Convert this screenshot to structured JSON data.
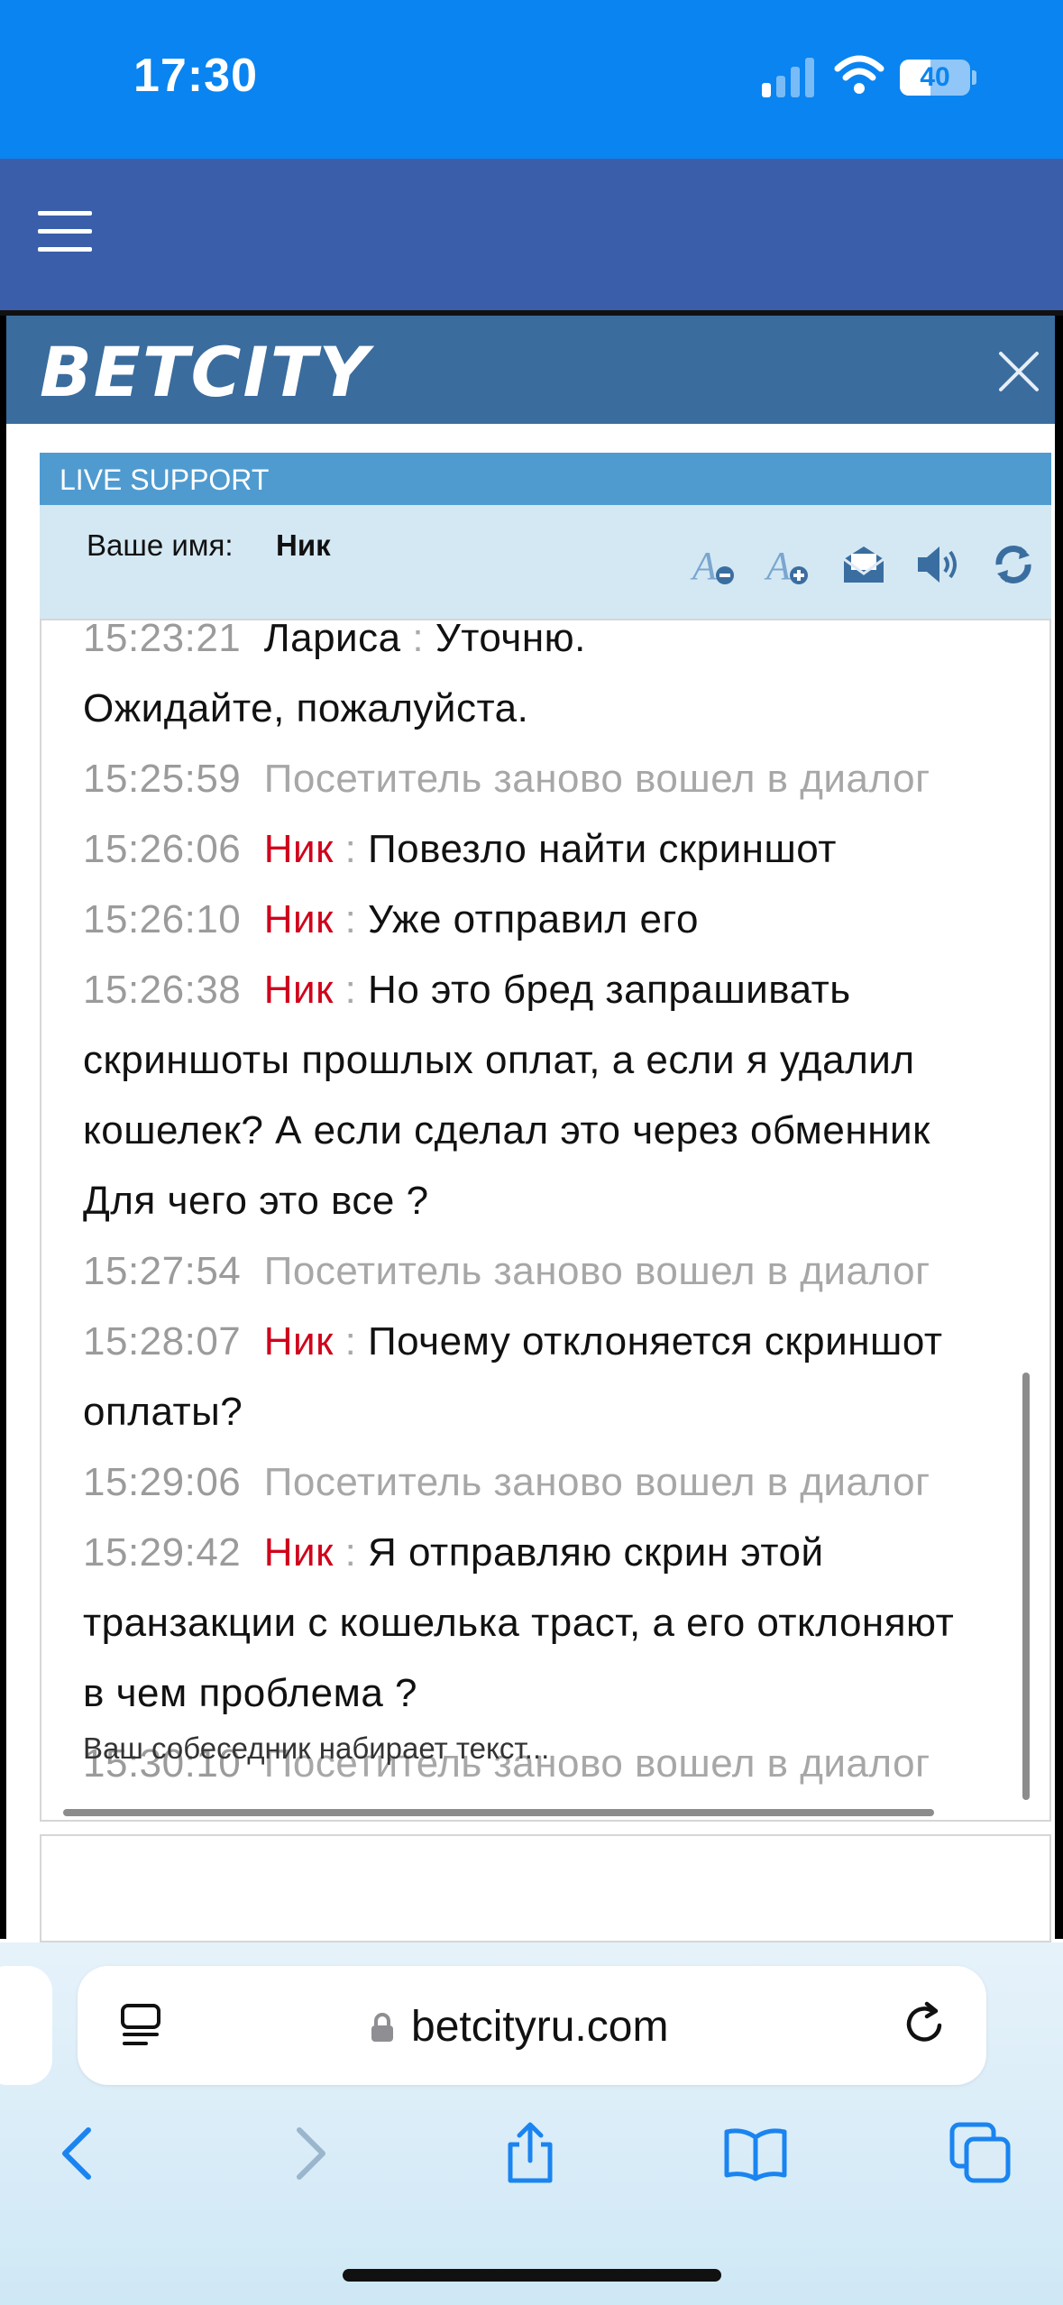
{
  "status": {
    "time": "17:30",
    "battery": "40"
  },
  "brand": {
    "logo_text": "BETCITY"
  },
  "support": {
    "header": "LIVE SUPPORT",
    "name_label": "Ваше имя:",
    "name_value": "Ник",
    "tools": [
      "font-decrease-icon",
      "font-increase-icon",
      "email-transcript-icon",
      "sound-icon",
      "refresh-icon"
    ]
  },
  "messages": [
    {
      "time": "15:23:21",
      "author": "Лариса",
      "sep": ":",
      "text": "Уточню."
    },
    {
      "cont": "Ожидайте, пожалуйста."
    },
    {
      "time": "15:25:59",
      "system": "Посетитель заново вошел в диалог"
    },
    {
      "time": "15:26:06",
      "author": "Ник",
      "sep": ":",
      "text": "Повезло найти скриншот"
    },
    {
      "time": "15:26:10",
      "author": "Ник",
      "sep": ":",
      "text": "Уже отправил его"
    },
    {
      "time": "15:26:38",
      "author": "Ник",
      "sep": ":",
      "text": "Но это бред запрашивать"
    },
    {
      "cont": "скриншоты прошлых оплат, а если я удалил"
    },
    {
      "cont": "кошелек? А если сделал это через обменник"
    },
    {
      "cont": "Для чего это все ?"
    },
    {
      "time": "15:27:54",
      "system": "Посетитель заново вошел в диалог"
    },
    {
      "time": "15:28:07",
      "author": "Ник",
      "sep": ":",
      "text": "Почему отклоняется скриншот"
    },
    {
      "cont": "оплаты?"
    },
    {
      "time": "15:29:06",
      "system": "Посетитель заново вошел в диалог"
    },
    {
      "time": "15:29:42",
      "author": "Ник",
      "sep": ":",
      "text": "Я отправляю скрин этой"
    },
    {
      "cont": "транзакции с кошелька траст, а его отклоняют"
    },
    {
      "cont": "в чем проблема ?"
    },
    {
      "time": "15:30:10",
      "system": "Посетитель заново вошел в диалог"
    }
  ],
  "typing_indicator": "Ваш собеседник набирает текст...",
  "browser": {
    "url": "betcityru.com"
  },
  "colors": {
    "status_bar": "#0a84f0",
    "site_nav": "#3a5eaa",
    "brand_bar": "#3a6c9e",
    "live_bar": "#4f9bd0",
    "nick": "#d0021b"
  }
}
